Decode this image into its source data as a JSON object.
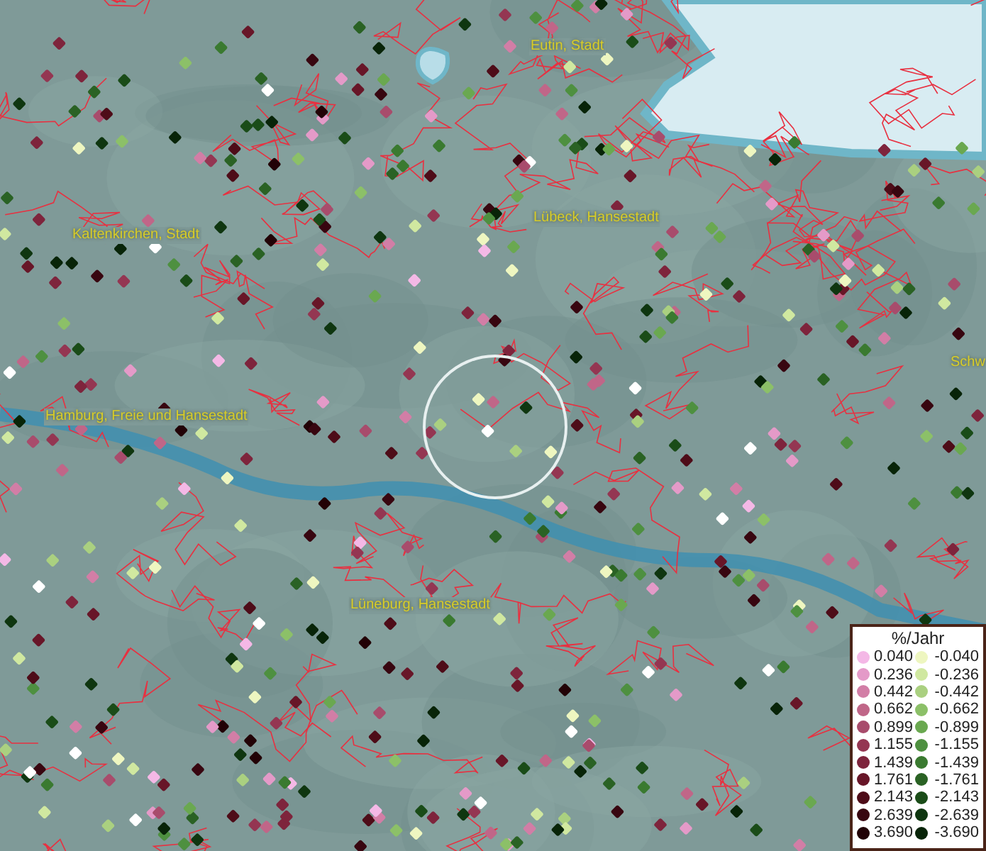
{
  "map": {
    "place_labels": [
      {
        "text": "Eutin, Stadt"
      },
      {
        "text": "Lübeck, Hansestadt"
      },
      {
        "text": "Kaltenkirchen, Stadt"
      },
      {
        "text": "Hamburg, Freie und Hansestadt"
      },
      {
        "text": "Lüneburg, Hansestadt"
      },
      {
        "text": "Schw"
      }
    ]
  },
  "legend": {
    "title": "%/Jahr",
    "rows": [
      {
        "positive": {
          "label": "0.040",
          "color": "#f4b8e6"
        },
        "negative": {
          "label": "-0.040",
          "color": "#eef6c0"
        }
      },
      {
        "positive": {
          "label": "0.236",
          "color": "#e49ac8"
        },
        "negative": {
          "label": "-0.236",
          "color": "#d0e8a0"
        }
      },
      {
        "positive": {
          "label": "0.442",
          "color": "#d27ea6"
        },
        "negative": {
          "label": "-0.442",
          "color": "#aad080"
        }
      },
      {
        "positive": {
          "label": "0.662",
          "color": "#c06688"
        },
        "negative": {
          "label": "-0.662",
          "color": "#8cc068"
        }
      },
      {
        "positive": {
          "label": "0.899",
          "color": "#a84c6c"
        },
        "negative": {
          "label": "-0.899",
          "color": "#6aa850"
        }
      },
      {
        "positive": {
          "label": "1.155",
          "color": "#943652"
        },
        "negative": {
          "label": "-1.155",
          "color": "#4e9040"
        }
      },
      {
        "positive": {
          "label": "1.439",
          "color": "#7e243c"
        },
        "negative": {
          "label": "-1.439",
          "color": "#3a7a30"
        }
      },
      {
        "positive": {
          "label": "1.761",
          "color": "#681628"
        },
        "negative": {
          "label": "-1.761",
          "color": "#2a6224"
        }
      },
      {
        "positive": {
          "label": "2.143",
          "color": "#4e0c18"
        },
        "negative": {
          "label": "-2.143",
          "color": "#1a4c18"
        }
      },
      {
        "positive": {
          "label": "2.639",
          "color": "#380610"
        },
        "negative": {
          "label": "-2.639",
          "color": "#0f3610"
        }
      },
      {
        "positive": {
          "label": "3.690",
          "color": "#220206"
        },
        "negative": {
          "label": "-3.690",
          "color": "#082408"
        }
      }
    ]
  }
}
